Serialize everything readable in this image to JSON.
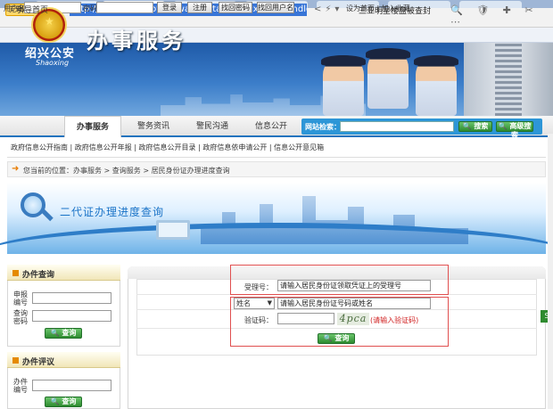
{
  "browser": {
    "site_badge": "党政机关",
    "url": "http://bsfw.sxga.gov.cn/was/portalsone/cxfw/secondldschedule.j",
    "search_suggestion": "三亚明星楼盘被查封"
  },
  "login": {
    "username_label": "用户名",
    "password_label": "密码",
    "login_btn": "登录",
    "register_btn": "注册",
    "find_password_btn": "找回密码",
    "find_username_btn": "找回用户名",
    "right_links": "设为首页 | 加入收藏"
  },
  "header": {
    "bureau_name": "绍兴公安",
    "bureau_en": "Shaoxing",
    "title": "办事服务"
  },
  "nav": {
    "items": [
      "引导首页",
      "办事服务",
      "警务资讯",
      "警民沟通",
      "信息公开"
    ],
    "search_label": "网站检索：",
    "search_btn": "搜索",
    "adv_search_btn": "高级搜索"
  },
  "subnav": "政府信息公开指南 | 政府信息公开年报 | 政府信息公开目录 | 政府信息依申请公开 | 信息公开意见箱",
  "breadcrumb": "您当前的位置：办事服务 > 查询服务 > 居民身份证办理进度查询",
  "feature": {
    "title": "二代证办理进度查询"
  },
  "left_query": {
    "title": "办件查询",
    "field1_label": "申报编号",
    "field2_label": "查询密码",
    "btn": "查询"
  },
  "left_eval": {
    "title": "办件评议",
    "field_label": "办件编号",
    "btn": "查询"
  },
  "form": {
    "receipt_label": "受理号：",
    "receipt_value": "请输入居民身份证领取凭证上的受理号",
    "select_value": "姓名",
    "id_value": "请输入居民身份证号码或姓名",
    "captcha_label": "验证码：",
    "captcha_text": "4pca",
    "captcha_hint": "(请输入验证码)",
    "submit_btn": "查询"
  },
  "side_float": "S"
}
